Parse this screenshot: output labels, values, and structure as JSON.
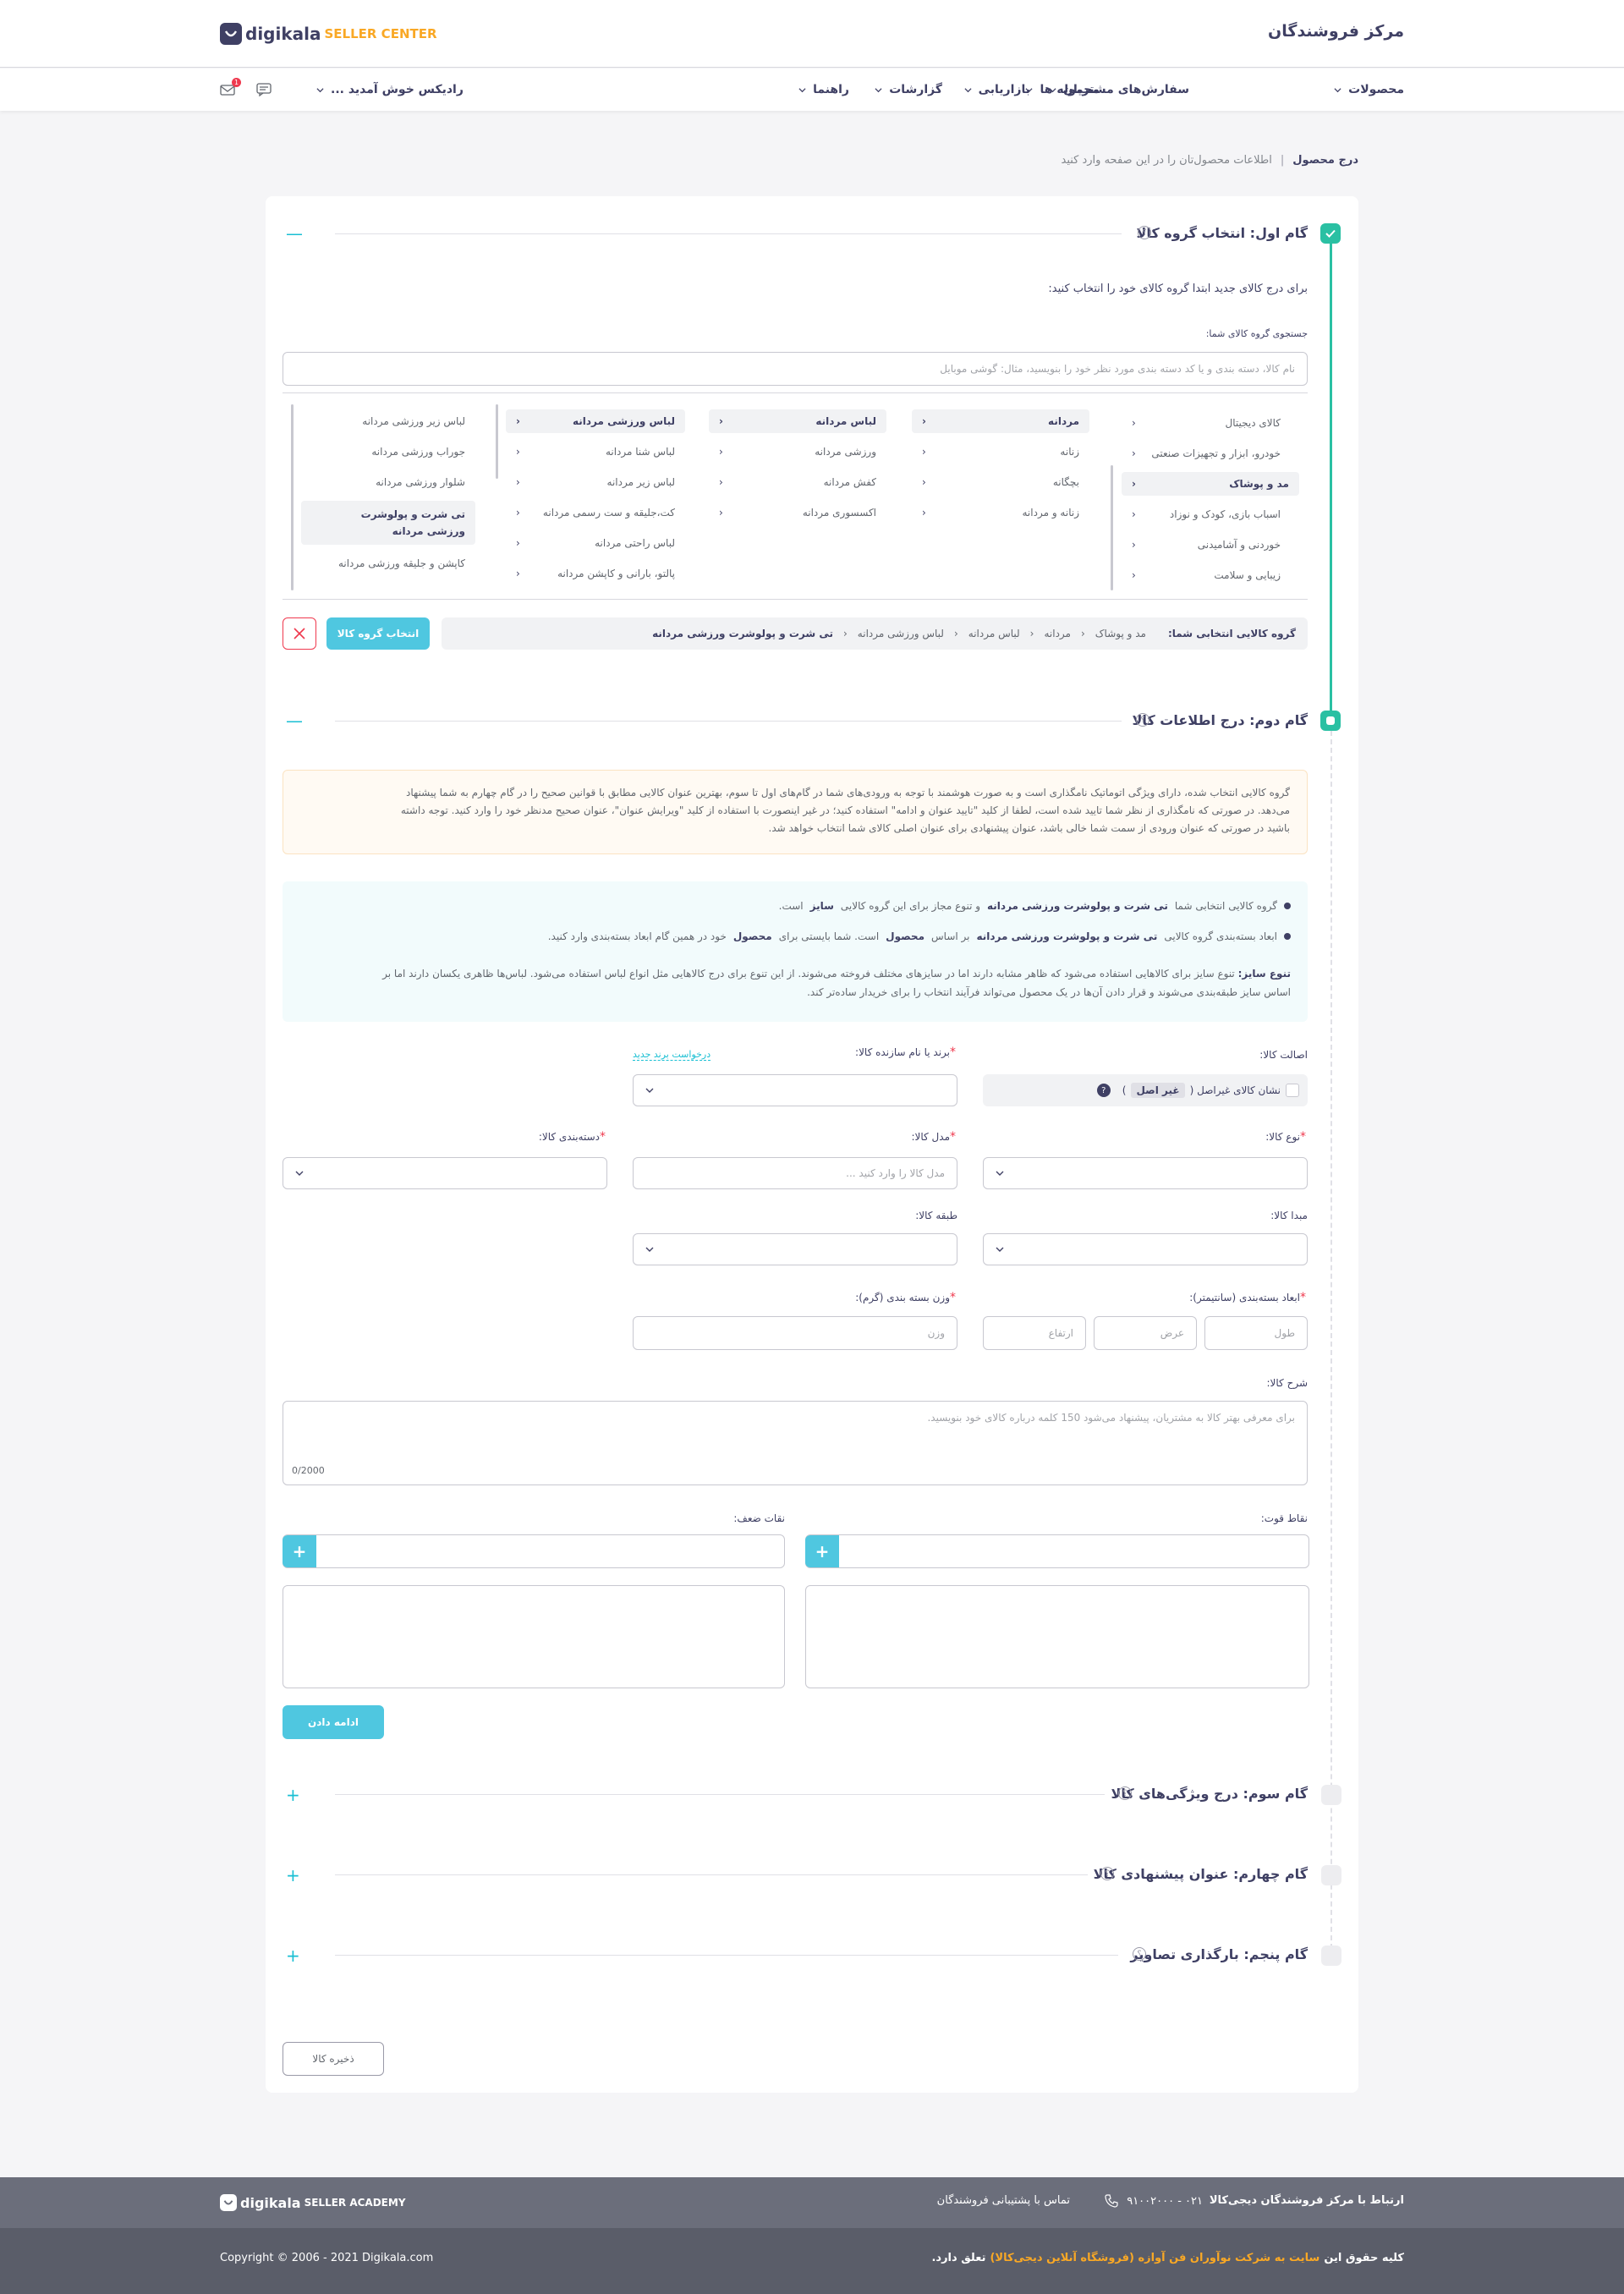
{
  "header": {
    "title": "مرکز فروشندگان",
    "logo_word": "digikala",
    "logo_sub": "SELLER CENTER"
  },
  "nav": {
    "items": [
      "محصولات",
      "سفارش‌های مشتریان",
      "محموله ها",
      "بازاریابی",
      "گزارشات",
      "راهنما"
    ],
    "welcome": "رادیکس خوش آمدید ...",
    "mail_badge": "1"
  },
  "breadcrumb": {
    "title": "درج محصول",
    "sep": "|",
    "desc": "اطلاعات محصول‌تان را در این صفحه وارد کنید"
  },
  "step1": {
    "title": "گام اول: انتخاب گروه کالا",
    "help": "؟",
    "collapse": "—",
    "intro": "برای درج کالای جدید ابتدا گروه کالای خود را انتخاب کنید:",
    "search_label": "جستجوی گروه کالای شما:",
    "search_placeholder": "نام کالا،  دسته بندی و یا کد دسته بندی مورد نظر خود را بنویسید، مثال: گوشی موبایل",
    "col1": [
      "کالای دیجیتال",
      "خودرو، ابزار و تجهیزات صنعتی",
      "مد و پوشاک",
      "اسباب بازی، کودک و نوزاد",
      "خوردنی و آشامیدنی",
      "زیبایی و سلامت"
    ],
    "col2": [
      "مردانه",
      "زنانه",
      "بچگانه",
      "زنانه و مردانه"
    ],
    "col3": [
      "لباس مردانه",
      "ورزشی مردانه",
      "کفش مردانه",
      "اکسسوری مردانه"
    ],
    "col4": [
      "لباس ورزشی مردانه",
      "لباس شنا مردانه",
      "لباس زیر مردانه",
      "کت،جلیقه و ست رسمی مردانه",
      "لباس راحتی مردانه",
      "پالتو، بارانی و کاپشن مردانه"
    ],
    "col5": [
      "لباس زیر ورزشی مردانه",
      "جوراب ورزشی مردانه",
      "شلوار ورزشی مردانه",
      "تی شرت و پولوشرت ورزشی مردانه",
      "کاپشن و جلیقه ورزشی مردانه"
    ],
    "selected_label": "گروه کالایی انتخابی شما:",
    "selected_path": [
      "مد و پوشاک",
      "مردانه",
      "لباس مردانه",
      "لباس ورزشی مردانه",
      "تی شرت و پولوشرت ورزشی مردانه"
    ],
    "select_button": "انتخاب گروه کالا"
  },
  "step2": {
    "title": "گام دوم: درج اطلاعات کالا",
    "help": "؟",
    "collapse": "—",
    "warning": [
      "گروه کالایی انتخاب شده، دارای ویژگی اتوماتیک نامگذاری است و به صورت هوشمند با توجه به ورودی‌های شما در گام‌های اول تا سوم، بهترین عنوان کالایی مطابق با قوانین صحیح را در گام چهارم به شما پیشنهاد",
      "می‌دهد. در صورتی که نامگذاری از نظر شما تایید شده است، لطفا از کلید \"تایید عنوان و ادامه\" استفاده کنید؛ در غیر اینصورت با استفاده از کلید \"ویرایش عنوان\"، عنوان صحیح مدنظر خود را وارد کنید. توجه داشته",
      "باشید در صورتی که عنوان ورودی از سمت شما خالی باشد، عنوان پیشنهادی برای عنوان اصلی کالای شما انتخاب خواهد شد."
    ],
    "info1": {
      "a": "گروه کالایی انتخابی شما",
      "b": "تی شرت و پولوشرت ورزشی مردانه",
      "c": "و تنوع مجاز برای این گروه کالایی",
      "d": "سایز",
      "e": "است."
    },
    "info2": {
      "a": "ابعاد بسته‌بندی گروه کالایی",
      "b": "تی شرت و پولوشرت ورزشی مردانه",
      "c": "بر اساس",
      "d": "محصول",
      "e": "است. شما بایستی برای",
      "f": "محصول",
      "g": "خود در همین گام ابعاد بسته‌بندی وارد کنید."
    },
    "info3": {
      "a": "تنوع سایز:",
      "b": "تنوع سایز برای کالاهایی استفاده می‌شود که ظاهر مشابه دارند اما در سایزهای مختلف فروخته می‌شوند. از این تنوع برای درج کالاهایی مثل انواع لباس استفاده می‌شود. لباس‌ها ظاهری یکسان دارند اما بر",
      "c": "اساس سایز طبقه‌بندی می‌شوند و قرار دادن آن‌ها در یک محصول می‌تواند فرآیند انتخاب را برای خریدار ساده‌تر کند."
    },
    "fields": {
      "authenticity_label": "اصالت کالا:",
      "fake_checkbox": "نشان کالای غیراصل (",
      "fake_badge": "غیر اصل",
      "fake_close": ")",
      "fake_help": "?",
      "brand_label": "برند یا نام سازنده کالا:",
      "brand_request": "درخواست برند جدید",
      "type_label": "نوع کالا:",
      "model_label": "مدل کالا:",
      "model_placeholder": "مدل کالا را وارد کنید ...",
      "category_label": "دسته‌بندی کالا:",
      "origin_label": "مبدا کالا:",
      "class_label": "طبقه کالا:",
      "dims_label": "ابعاد بسته‌بندی (سانتیمتر):",
      "length_ph": "طول",
      "width_ph": "عرض",
      "height_ph": "ارتفاع",
      "weight_label": "وزن بسته بندی (گرم):",
      "weight_ph": "وزن",
      "desc_label": "شرح کالا:",
      "desc_ph": "برای معرفی بهتر کالا به مشتریان، پیشنهاد می‌شود 150 کلمه درباره کالای خود بنویسید.",
      "desc_counter": "0/2000",
      "strengths_label": "نقاط قوت:",
      "weaknesses_label": "نقات ضعف:",
      "plus": "+",
      "continue_button": "ادامه دادن"
    }
  },
  "step3": {
    "title": "گام سوم: درج ویژگی‌های کالا",
    "help": "؟",
    "expand": "+"
  },
  "step4": {
    "title": "گام چهارم: عنوان پیشنهادی کالا",
    "help": "؟",
    "expand": "+"
  },
  "step5": {
    "title": "گام پنجم: بارگذاری تصاویر",
    "help": "؟",
    "expand": "+"
  },
  "save_button": "ذخیره کالا",
  "footer": {
    "contact_title": "ارتباط با مرکز فروشندگان دیجی‌کالا",
    "phone": "۰۲۱ - ۹۱۰۰۲۰۰۰",
    "support": "تماس با پشتیبانی فروشندگان",
    "academy_word": "digikala",
    "academy_sub": "SELLER ACADEMY",
    "rights_a": "کلیه حقوق این",
    "rights_b": "سایت به شرکت نوآوران فن آوازه (فروشگاه آنلاین دیجی‌کالا)",
    "rights_c": "تعلق دارد.",
    "copyright": "Copyright © 2006 - 2021 Digikala.com"
  },
  "colors": {
    "accent": "#19bfd3",
    "button": "#4fc7e0",
    "step_done": "#2ac0a3",
    "danger": "#ef394e",
    "brand_orange": "#f9a825",
    "text": "#3f4064",
    "footer_top": "#6b6e7b",
    "footer_bottom": "#5a5d69"
  }
}
